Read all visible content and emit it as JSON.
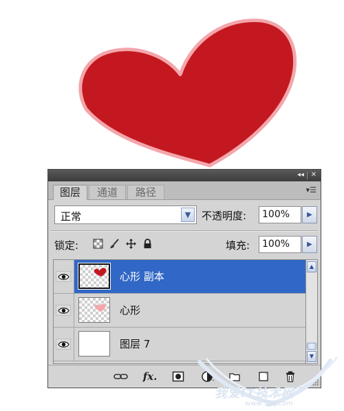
{
  "artwork": {
    "heart_fill": "#c3181f",
    "heart_outline": "#f3a6ab"
  },
  "panel": {
    "tabs": [
      {
        "label": "图层",
        "active": true
      },
      {
        "label": "通道",
        "active": false
      },
      {
        "label": "路径",
        "active": false
      }
    ],
    "blend_mode": "正常",
    "opacity_label": "不透明度:",
    "opacity_value": "100%",
    "lock_label": "锁定:",
    "fill_label": "填充:",
    "fill_value": "100%",
    "selection_color": "#3167c6",
    "layers": [
      {
        "name": "心形 副本",
        "selected": true,
        "thumbnail": "heart-red"
      },
      {
        "name": "心形",
        "selected": false,
        "thumbnail": "heart-pink"
      },
      {
        "name": "图层 7",
        "selected": false,
        "thumbnail": "white"
      }
    ],
    "bottom_icons": [
      "link-icon",
      "fx-icon",
      "mask-icon",
      "adjustment-icon",
      "group-icon",
      "new-layer-icon",
      "trash-icon"
    ]
  },
  "watermark": {
    "text": "我爱IT技术网",
    "url": "www.52ij.com"
  }
}
